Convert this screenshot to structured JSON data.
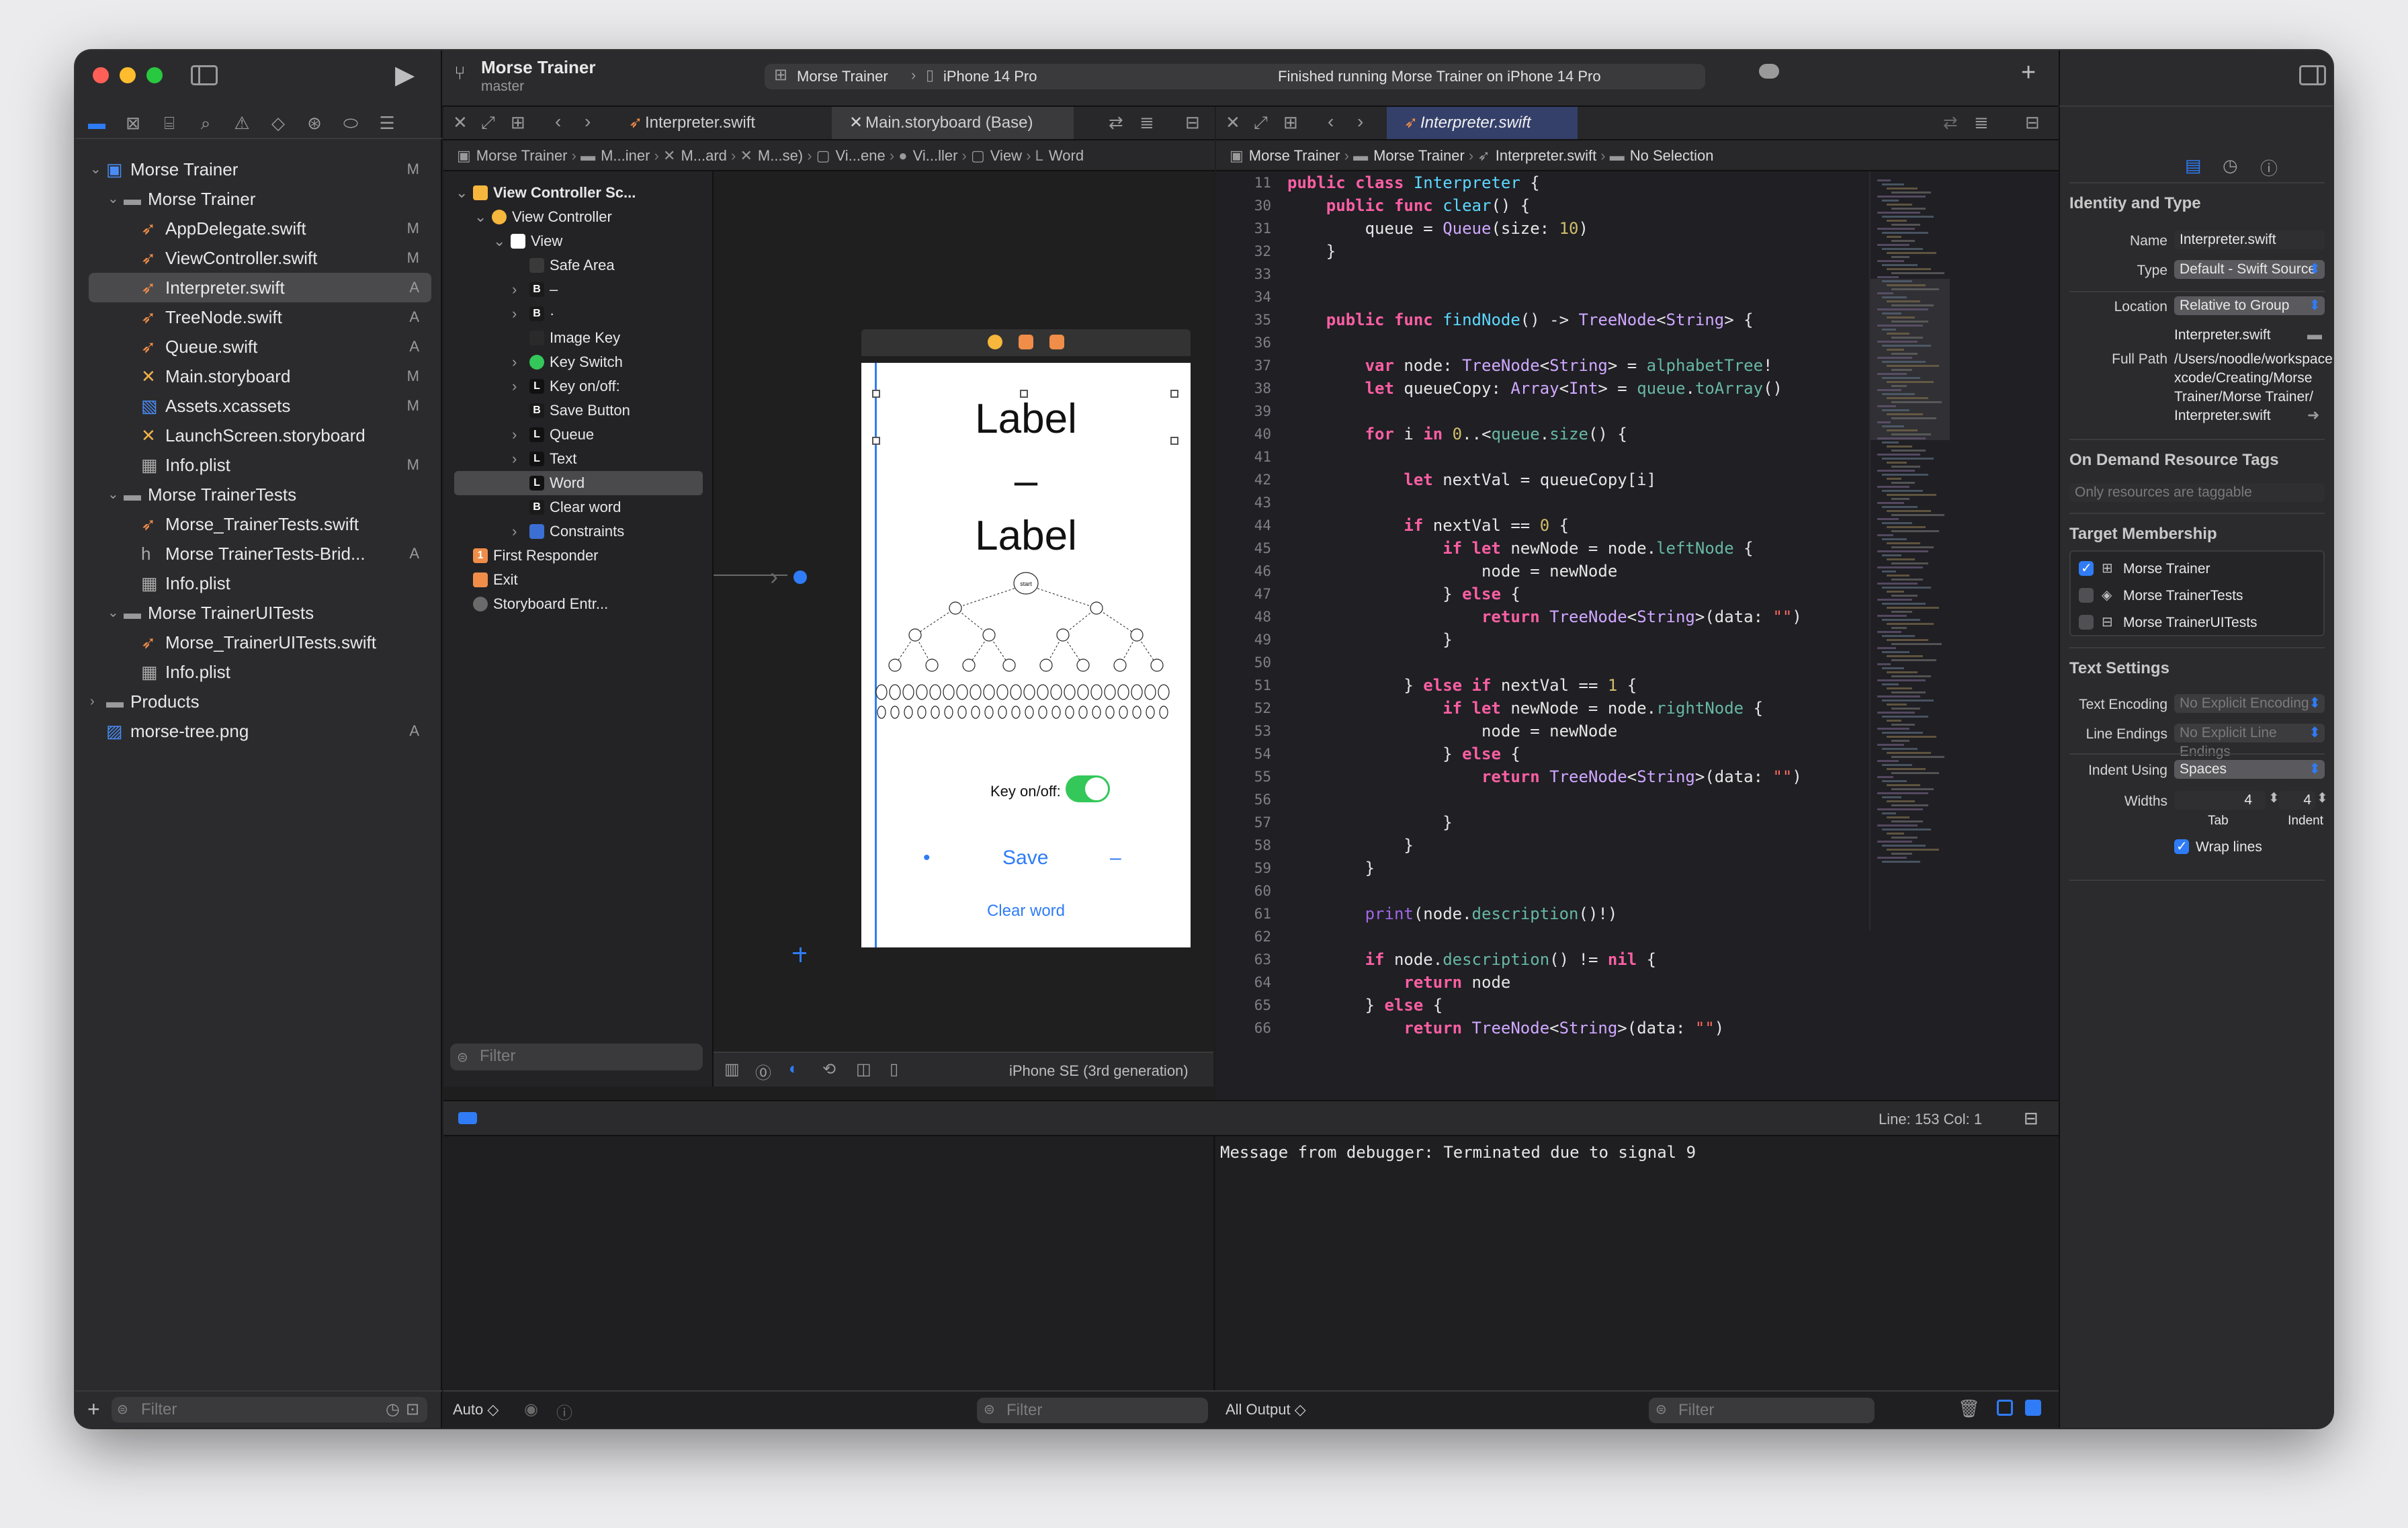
{
  "toolbar": {
    "project_name": "Morse Trainer",
    "branch": "master",
    "scheme": "Morse Trainer",
    "destination": "iPhone 14 Pro",
    "status": "Finished running Morse Trainer on iPhone 14 Pro"
  },
  "navigator": {
    "items": [
      {
        "label": "Morse Trainer",
        "status": "M",
        "kind": "project-icon",
        "indent": 0,
        "chevron": "v"
      },
      {
        "label": "Morse Trainer",
        "status": "",
        "kind": "folder-icon",
        "indent": 1,
        "chevron": "v"
      },
      {
        "label": "AppDelegate.swift",
        "status": "M",
        "kind": "swift-file-icon",
        "indent": 2,
        "chevron": ""
      },
      {
        "label": "ViewController.swift",
        "status": "M",
        "kind": "swift-file-icon",
        "indent": 2,
        "chevron": ""
      },
      {
        "label": "Interpreter.swift",
        "status": "A",
        "kind": "swift-file-icon",
        "indent": 2,
        "chevron": "",
        "selected": true
      },
      {
        "label": "TreeNode.swift",
        "status": "A",
        "kind": "swift-file-icon",
        "indent": 2,
        "chevron": ""
      },
      {
        "label": "Queue.swift",
        "status": "A",
        "kind": "swift-file-icon",
        "indent": 2,
        "chevron": ""
      },
      {
        "label": "Main.storyboard",
        "status": "M",
        "kind": "storyboard-icon",
        "indent": 2,
        "chevron": ""
      },
      {
        "label": "Assets.xcassets",
        "status": "M",
        "kind": "assets-icon",
        "indent": 2,
        "chevron": ""
      },
      {
        "label": "LaunchScreen.storyboard",
        "status": "",
        "kind": "storyboard-icon",
        "indent": 2,
        "chevron": ""
      },
      {
        "label": "Info.plist",
        "status": "M",
        "kind": "plist-icon",
        "indent": 2,
        "chevron": ""
      },
      {
        "label": "Morse TrainerTests",
        "status": "",
        "kind": "folder-icon",
        "indent": 1,
        "chevron": "v"
      },
      {
        "label": "Morse_TrainerTests.swift",
        "status": "",
        "kind": "swift-file-icon",
        "indent": 2,
        "chevron": ""
      },
      {
        "label": "Morse TrainerTests-Brid...",
        "status": "A",
        "kind": "header-file-icon",
        "indent": 2,
        "chevron": ""
      },
      {
        "label": "Info.plist",
        "status": "",
        "kind": "plist-icon",
        "indent": 2,
        "chevron": ""
      },
      {
        "label": "Morse TrainerUITests",
        "status": "",
        "kind": "folder-icon",
        "indent": 1,
        "chevron": "v"
      },
      {
        "label": "Morse_TrainerUITests.swift",
        "status": "",
        "kind": "swift-file-icon",
        "indent": 2,
        "chevron": ""
      },
      {
        "label": "Info.plist",
        "status": "",
        "kind": "plist-icon",
        "indent": 2,
        "chevron": ""
      },
      {
        "label": "Products",
        "status": "",
        "kind": "folder-icon",
        "indent": 0,
        "chevron": ">"
      },
      {
        "label": "morse-tree.png",
        "status": "A",
        "kind": "image-file-icon",
        "indent": 0,
        "chevron": ""
      }
    ],
    "filter_placeholder": "Filter"
  },
  "left_editor": {
    "tab1": "Interpreter.swift",
    "tab2": "Main.storyboard (Base)",
    "breadcrumb": [
      "Morse Trainer",
      "M...iner",
      "M...ard",
      "M...se)",
      "Vi...ene",
      "Vi...ller",
      "View",
      "Word"
    ],
    "outline": [
      {
        "label": "View Controller Sc...",
        "indent": 0,
        "chevron": "v",
        "icon": "scene-icon",
        "bold": true
      },
      {
        "label": "View Controller",
        "indent": 1,
        "chevron": "v",
        "icon": "view-controller-icon"
      },
      {
        "label": "View",
        "indent": 2,
        "chevron": "v",
        "icon": "view-icon"
      },
      {
        "label": "Safe Area",
        "indent": 3,
        "chevron": "",
        "icon": "safe-area-icon"
      },
      {
        "label": "–",
        "indent": 3,
        "chevron": ">",
        "icon": "button-icon"
      },
      {
        "label": "·",
        "indent": 3,
        "chevron": ">",
        "icon": "button-icon"
      },
      {
        "label": "Image Key",
        "indent": 3,
        "chevron": "",
        "icon": "image-view-icon"
      },
      {
        "label": "Key Switch",
        "indent": 3,
        "chevron": ">",
        "icon": "switch-icon"
      },
      {
        "label": "Key on/off:",
        "indent": 3,
        "chevron": ">",
        "icon": "label-icon"
      },
      {
        "label": "Save Button",
        "indent": 3,
        "chevron": "",
        "icon": "button-icon"
      },
      {
        "label": "Queue",
        "indent": 3,
        "chevron": ">",
        "icon": "label-icon"
      },
      {
        "label": "Text",
        "indent": 3,
        "chevron": ">",
        "icon": "label-icon"
      },
      {
        "label": "Word",
        "indent": 3,
        "chevron": "",
        "icon": "label-icon",
        "selected": true
      },
      {
        "label": "Clear word",
        "indent": 3,
        "chevron": "",
        "icon": "button-icon"
      },
      {
        "label": "Constraints",
        "indent": 3,
        "chevron": ">",
        "icon": "constraints-icon"
      },
      {
        "label": "First Responder",
        "indent": 0,
        "chevron": "",
        "icon": "first-responder-icon"
      },
      {
        "label": "Exit",
        "indent": 0,
        "chevron": "",
        "icon": "exit-icon"
      },
      {
        "label": "Storyboard Entr...",
        "indent": 0,
        "chevron": "",
        "icon": "storyboard-entry-icon"
      }
    ],
    "outline_filter_placeholder": "Filter",
    "device": "iPhone SE (3rd generation)",
    "phone": {
      "label1": "Label",
      "dash": "–",
      "label2": "Label",
      "key_label": "Key on/off:",
      "dot_button": "•",
      "save_button": "Save",
      "dash_button": "–",
      "clear_button": "Clear word",
      "tree_root": "start"
    }
  },
  "right_editor": {
    "tab": "Interpreter.swift",
    "breadcrumb": [
      "Morse Trainer",
      "Morse Trainer",
      "Interpreter.swift",
      "No Selection"
    ],
    "line_numbers": [
      "11",
      "30",
      "31",
      "32",
      "33",
      "34",
      "35",
      "36",
      "37",
      "38",
      "39",
      "40",
      "41",
      "42",
      "43",
      "44",
      "45",
      "46",
      "47",
      "48",
      "49",
      "50",
      "51",
      "52",
      "53",
      "54",
      "55",
      "56",
      "57",
      "58",
      "59",
      "60",
      "61",
      "62",
      "63",
      "64",
      "65",
      "66"
    ]
  },
  "debug": {
    "position": "Line: 153  Col: 1",
    "console_message": "Message from debugger: Terminated due to signal 9",
    "auto_label": "Auto ◇",
    "vars_filter": "Filter",
    "output_label": "All Output ◇",
    "console_filter": "Filter"
  },
  "inspector": {
    "identity_title": "Identity and Type",
    "name_label": "Name",
    "name_value": "Interpreter.swift",
    "type_label": "Type",
    "type_value": "Default - Swift Source",
    "location_label": "Location",
    "location_value": "Relative to Group",
    "location_file": "Interpreter.swift",
    "fullpath_label": "Full Path",
    "fullpath_lines": [
      "/Users/noodle/workspace/",
      "xcode/Creating/Morse",
      "Trainer/Morse Trainer/",
      "Interpreter.swift"
    ],
    "odr_title": "On Demand Resource Tags",
    "odr_placeholder": "Only resources are taggable",
    "target_title": "Target Membership",
    "targets": [
      {
        "label": "Morse Trainer",
        "checked": true
      },
      {
        "label": "Morse TrainerTests",
        "checked": false
      },
      {
        "label": "Morse TrainerUITests",
        "checked": false
      }
    ],
    "text_title": "Text Settings",
    "encoding_label": "Text Encoding",
    "encoding_value": "No Explicit Encoding",
    "endings_label": "Line Endings",
    "endings_value": "No Explicit Line Endings",
    "indent_label": "Indent Using",
    "indent_value": "Spaces",
    "widths_label": "Widths",
    "tab_value": "4",
    "indent_width_value": "4",
    "tab_caption": "Tab",
    "indent_caption": "Indent",
    "wrap_label": "Wrap lines"
  },
  "colors": {
    "accent": "#2f7cf6",
    "swift": "#f08d49",
    "keyword": "#fc5fa3",
    "type": "#d0a8ff",
    "number": "#d0bf69",
    "string": "#fc6a5d",
    "function": "#67b7a4"
  }
}
